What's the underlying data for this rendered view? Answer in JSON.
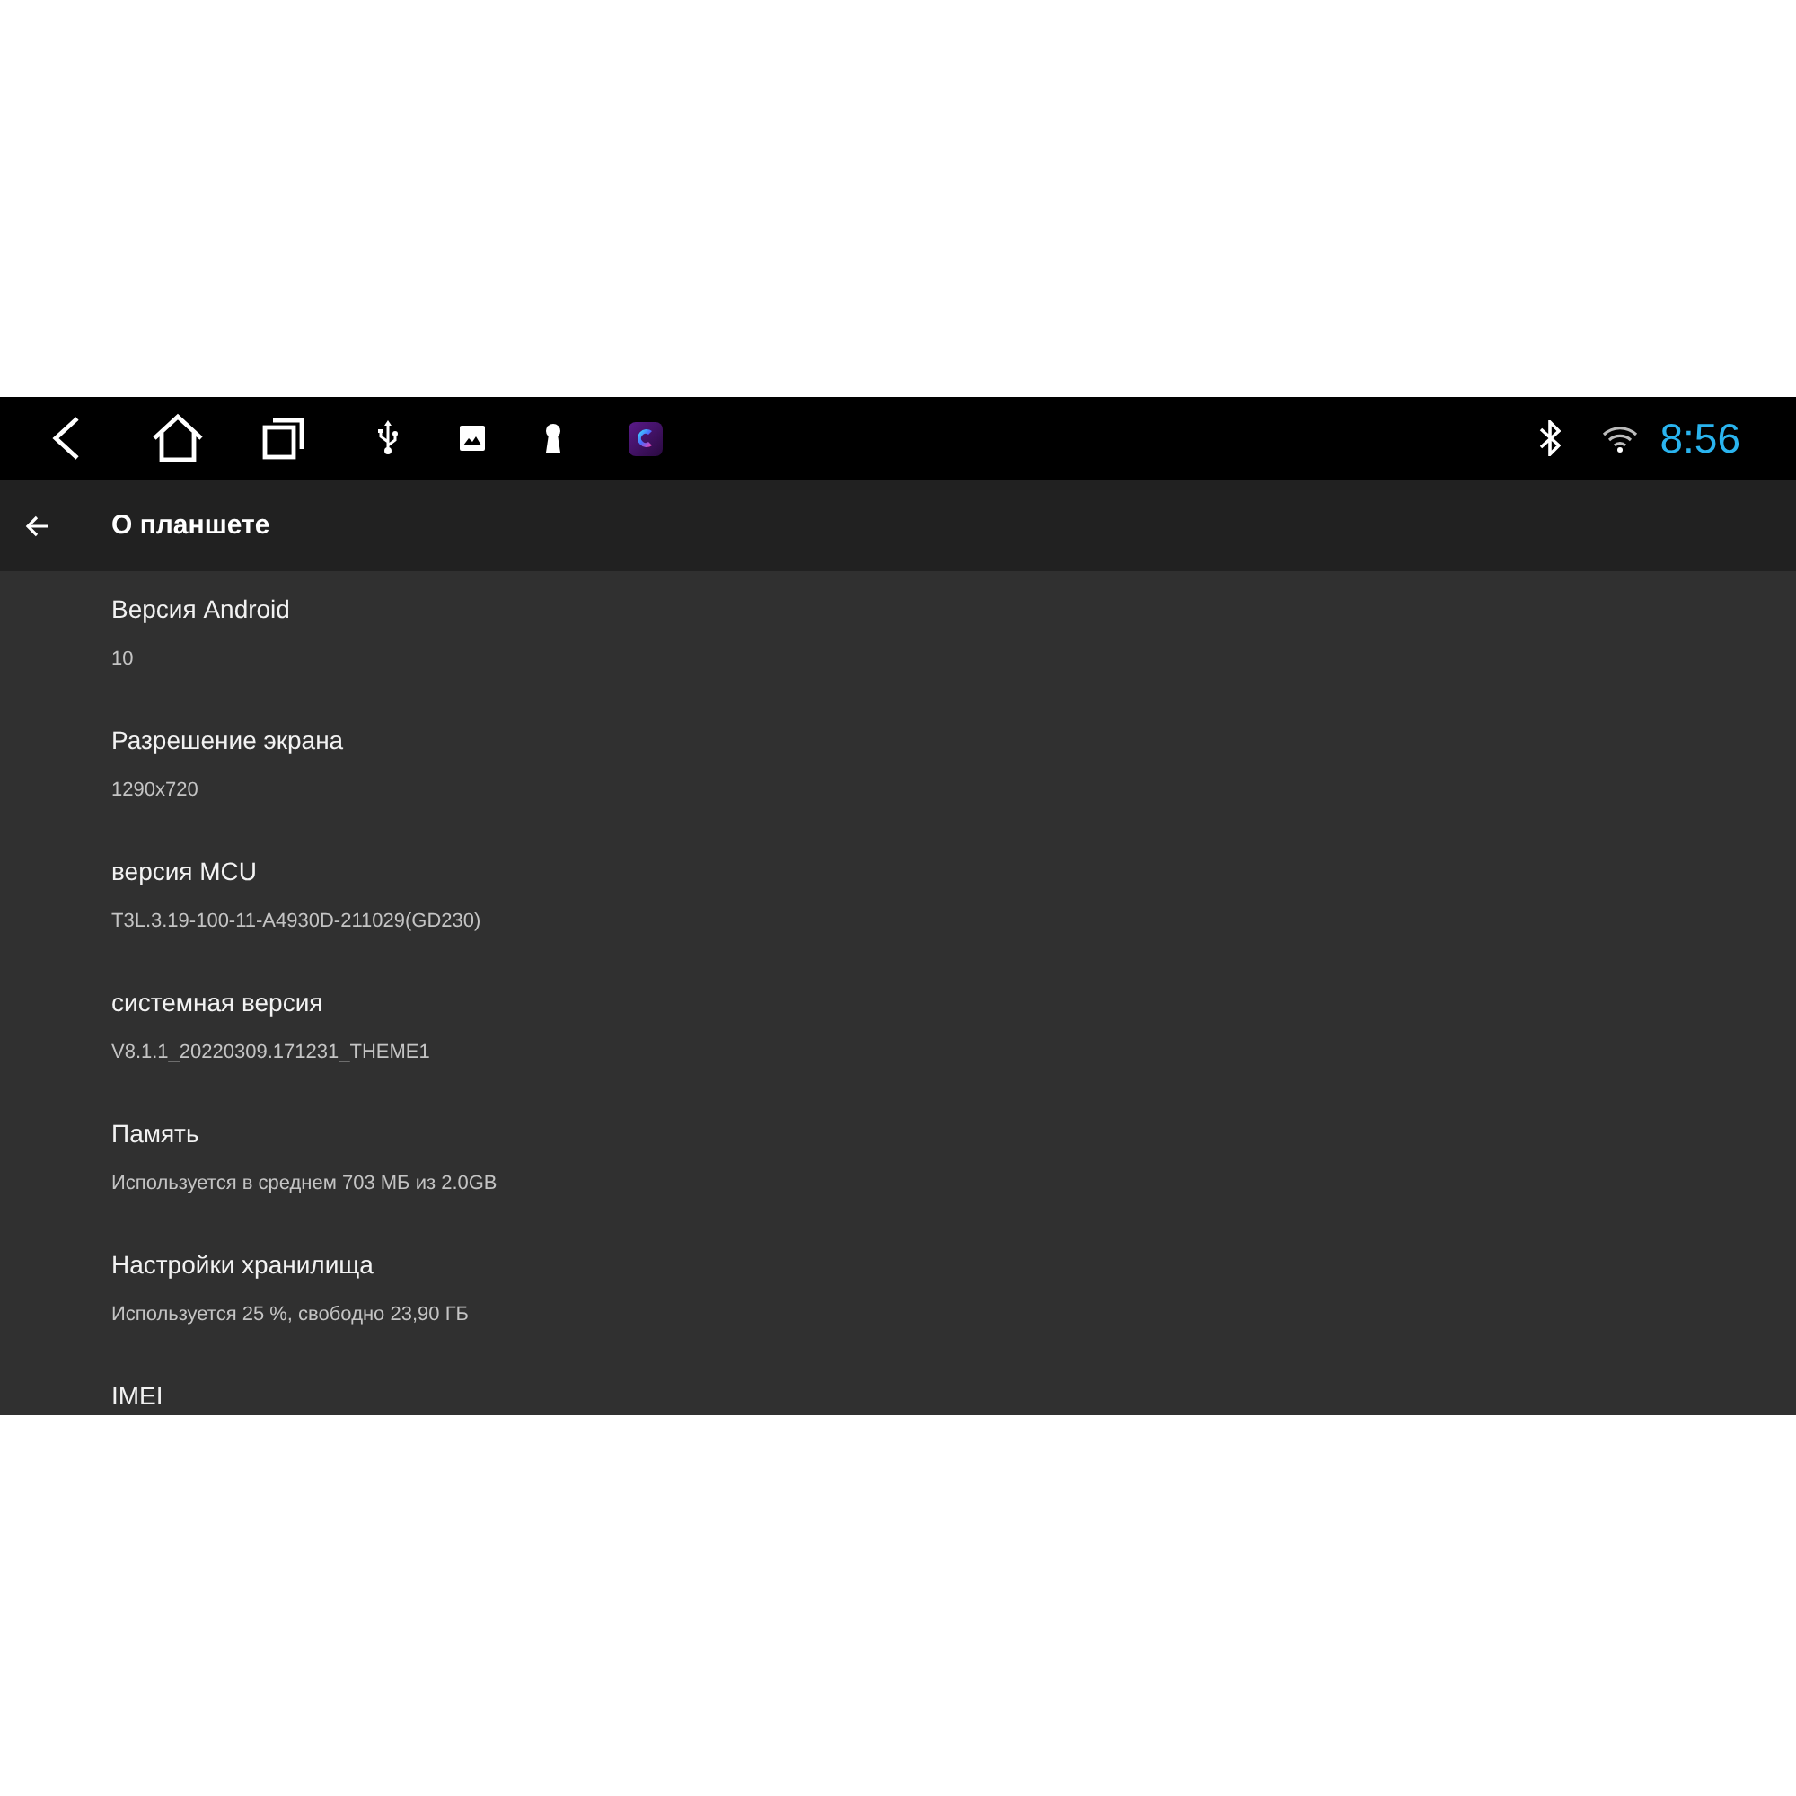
{
  "status_bar": {
    "time": "8:56"
  },
  "app_bar": {
    "title": "О планшете"
  },
  "items": [
    {
      "title": "Версия Android",
      "summary": "10"
    },
    {
      "title": "Разрешение экрана",
      "summary": "1290x720"
    },
    {
      "title": "версия MCU",
      "summary": "T3L.3.19-100-11-A4930D-211029(GD230)"
    },
    {
      "title": "системная версия",
      "summary": "V8.1.1_20220309.171231_THEME1"
    },
    {
      "title": "Память",
      "summary": "Используется в среднем 703 МБ из 2.0GB"
    },
    {
      "title": "Настройки хранилища",
      "summary": "Используется 25 %, свободно 23,90 ГБ"
    },
    {
      "title": "IMEI"
    }
  ]
}
